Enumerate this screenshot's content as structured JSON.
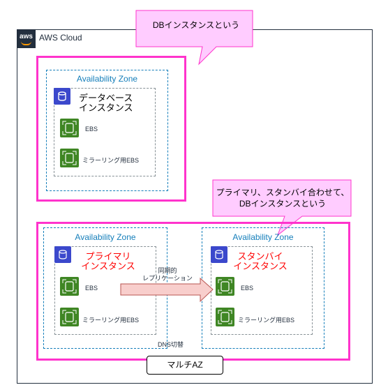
{
  "cloud": {
    "logo": "aws",
    "label": "AWS Cloud"
  },
  "callout_top": "DBインスタンスという",
  "callout_bottom": [
    "プライマリ、スタンバイ合わせて、",
    "DBインスタンスという"
  ],
  "top_group": {
    "az_label": "Availability Zone",
    "instance_title": [
      "データベース",
      "インスタンス"
    ],
    "ebs": "EBS",
    "mirror_ebs": "ミラーリング用EBS"
  },
  "primary": {
    "az_label": "Availability Zone",
    "title": [
      "プライマリ",
      "インスタンス"
    ],
    "ebs": "EBS",
    "mirror_ebs": "ミラーリング用EBS"
  },
  "standby": {
    "az_label": "Availability Zone",
    "title": [
      "スタンバイ",
      "インスタンス"
    ],
    "ebs": "EBS",
    "mirror_ebs": "ミラーリング用EBS"
  },
  "arrow_label": [
    "同期的",
    "レプリケーション"
  ],
  "dns_label": "DNS切替",
  "multi_az": "マルチAZ",
  "colors": {
    "pink": "#ff33cc",
    "callout_fill": "#ffccff",
    "az": "#147eba",
    "red_text": "#ff0000",
    "arrow_fill": "#f8cecc",
    "arrow_stroke": "#b85450"
  }
}
